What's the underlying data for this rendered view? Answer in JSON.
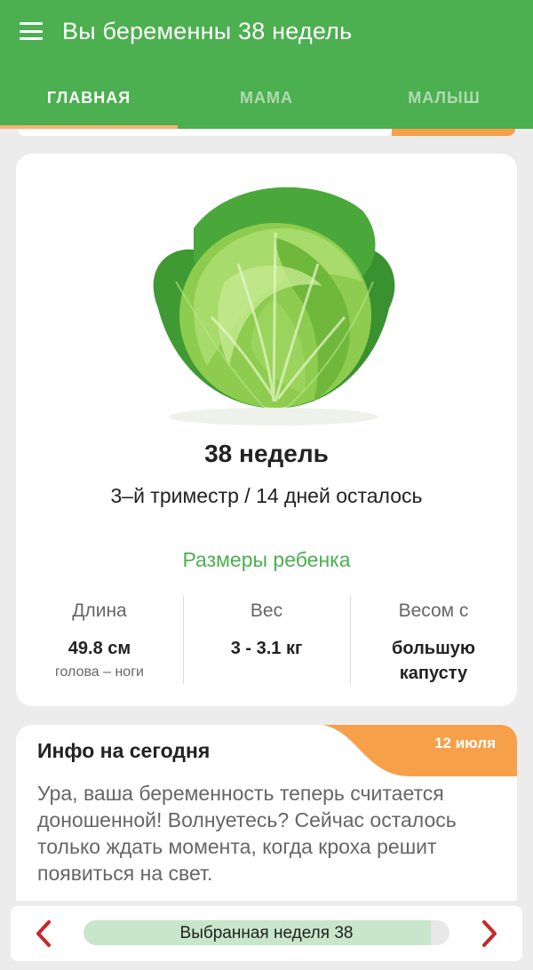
{
  "header": {
    "title": "Вы беременны 38 недель"
  },
  "tabs": [
    {
      "label": "ГЛАВНАЯ",
      "active": true
    },
    {
      "label": "МАМА",
      "active": false
    },
    {
      "label": "МАЛЫШ",
      "active": false
    }
  ],
  "main_card": {
    "illustration": "cabbage-image",
    "week_title": "38 недель",
    "trimester_text": "3–й триместр / 14 дней осталось",
    "sizes_title": "Размеры ребенка",
    "stats": [
      {
        "label": "Длина",
        "value": "49.8 см",
        "sub": "голова – ноги"
      },
      {
        "label": "Вес",
        "value": "3 - 3.1 кг",
        "sub": ""
      },
      {
        "label": "Весом с",
        "value": "большую капусту",
        "sub": ""
      }
    ]
  },
  "info_card": {
    "title": "Инфо на сегодня",
    "date": "12 июля",
    "text": "Ура, ваша беременность теперь считается доношенной! Волнуетесь? Сейчас осталось только ждать момента, когда кроха решит появиться на свет."
  },
  "bottom_bar": {
    "label": "Выбранная неделя 38",
    "progress": 0.95,
    "prev_icon": "chevron-left-icon",
    "next_icon": "chevron-right-icon"
  },
  "colors": {
    "primary": "#4caf50",
    "accent": "#f7a04a",
    "progress_fill": "#c8e6c9",
    "arrow": "#c62828"
  }
}
